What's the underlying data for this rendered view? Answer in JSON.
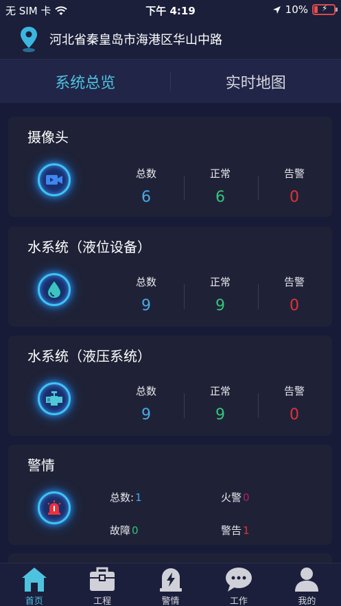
{
  "status_bar": {
    "carrier": "无 SIM 卡",
    "time": "下午 4:19",
    "battery": "10%"
  },
  "location": {
    "address": "河北省秦皇岛市海港区华山中路",
    "icon": "location-pin-icon"
  },
  "tabs": [
    {
      "label": "系统总览",
      "active": true
    },
    {
      "label": "实时地图",
      "active": false
    }
  ],
  "cards": [
    {
      "title": "摄像头",
      "icon": "video-camera-icon",
      "stats": [
        {
          "label": "总数",
          "value": "6"
        },
        {
          "label": "正常",
          "value": "6"
        },
        {
          "label": "告警",
          "value": "0"
        }
      ]
    },
    {
      "title": "水系统（液位设备）",
      "icon": "water-drop-icon",
      "stats": [
        {
          "label": "总数",
          "value": "9"
        },
        {
          "label": "正常",
          "value": "9"
        },
        {
          "label": "告警",
          "value": "0"
        }
      ]
    },
    {
      "title": "水系统（液压系统）",
      "icon": "valve-icon",
      "stats": [
        {
          "label": "总数",
          "value": "9"
        },
        {
          "label": "正常",
          "value": "9"
        },
        {
          "label": "告警",
          "value": "0"
        }
      ]
    },
    {
      "title": "警情",
      "icon": "siren-icon",
      "items": [
        {
          "label": "总数:",
          "value": "1"
        },
        {
          "label": "火警",
          "value": "0"
        },
        {
          "label": "故障",
          "value": "0"
        },
        {
          "label": "警告",
          "value": "1"
        }
      ]
    }
  ],
  "bottom_nav": [
    {
      "label": "首页",
      "icon": "home-icon",
      "active": true
    },
    {
      "label": "工程",
      "icon": "toolbox-icon",
      "active": false
    },
    {
      "label": "警情",
      "icon": "alarm-lightning-icon",
      "active": false
    },
    {
      "label": "工作",
      "icon": "chat-bubble-icon",
      "active": false
    },
    {
      "label": "我的",
      "icon": "user-icon",
      "active": false
    }
  ],
  "colors": {
    "accent": "#4ec3e0",
    "total": "#4aa8e8",
    "normal": "#34c47c",
    "alarm": "#e0323a",
    "fire": "#b0206a"
  }
}
